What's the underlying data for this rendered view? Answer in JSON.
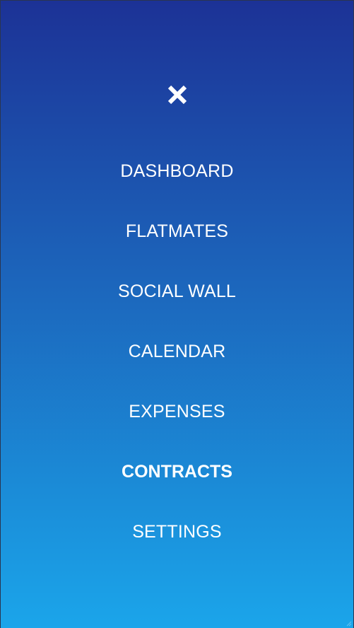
{
  "colors": {
    "gradient_top": "#1c3296",
    "gradient_bottom": "#1ba5ea",
    "text": "#ffffff"
  },
  "close_icon": "close-icon",
  "menu": {
    "items": [
      {
        "label": "DASHBOARD",
        "active": false
      },
      {
        "label": "FLATMATES",
        "active": false
      },
      {
        "label": "SOCIAL WALL",
        "active": false
      },
      {
        "label": "CALENDAR",
        "active": false
      },
      {
        "label": "EXPENSES",
        "active": false
      },
      {
        "label": "CONTRACTS",
        "active": true
      },
      {
        "label": "SETTINGS",
        "active": false
      }
    ]
  }
}
